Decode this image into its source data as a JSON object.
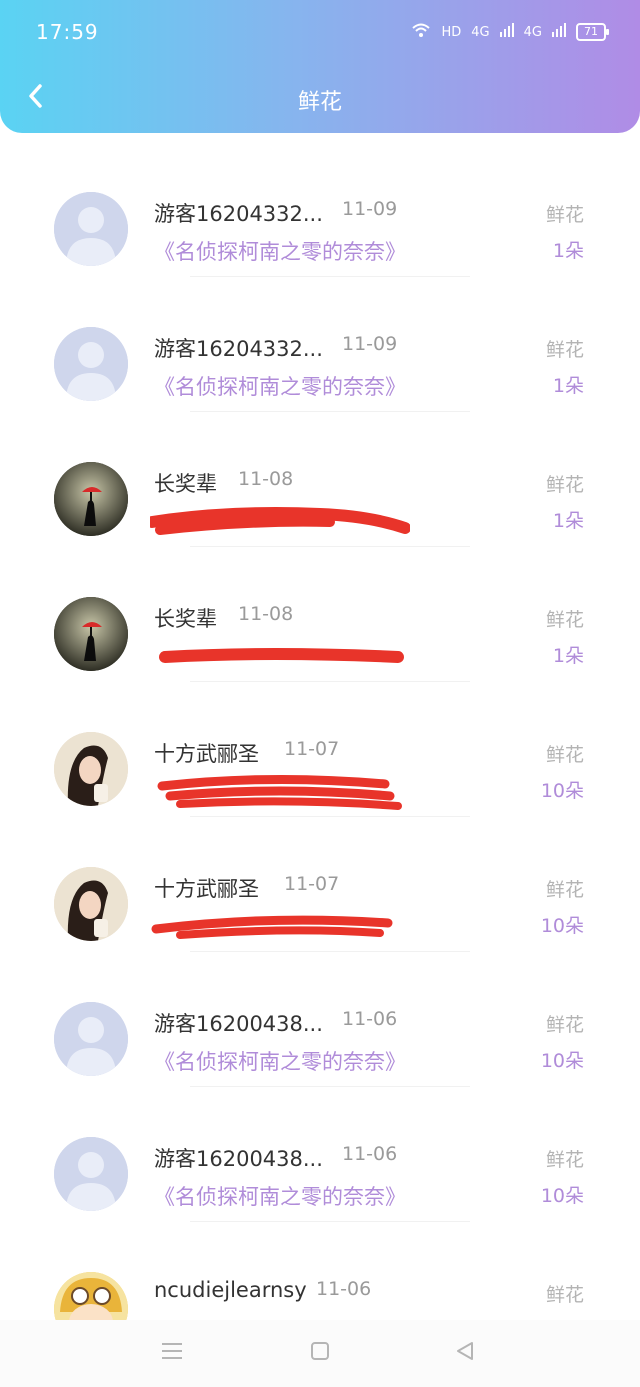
{
  "status_bar": {
    "time": "17:59",
    "network": "HD",
    "signal1": "4G",
    "signal2": "4G",
    "battery": "71"
  },
  "header": {
    "title": "鲜花"
  },
  "records": [
    {
      "name": "游客16204332...",
      "date": "11-09",
      "book": "《名侦探柯南之零的奈奈》",
      "gift_type": "鲜花",
      "count": "1朵",
      "avatar": "default"
    },
    {
      "name": "游客16204332...",
      "date": "11-09",
      "book": "《名侦探柯南之零的奈奈》",
      "gift_type": "鲜花",
      "count": "1朵",
      "avatar": "default"
    },
    {
      "name": "长奖辈",
      "date": "11-08",
      "book": "",
      "gift_type": "鲜花",
      "count": "1朵",
      "avatar": "umbrella-photo"
    },
    {
      "name": "长奖辈",
      "date": "11-08",
      "book": "",
      "gift_type": "鲜花",
      "count": "1朵",
      "avatar": "umbrella-photo"
    },
    {
      "name": "十方武郦圣",
      "date": "11-07",
      "book": "",
      "gift_type": "鲜花",
      "count": "10朵",
      "avatar": "girl-photo"
    },
    {
      "name": "十方武郦圣",
      "date": "11-07",
      "book": "",
      "gift_type": "鲜花",
      "count": "10朵",
      "avatar": "girl-photo"
    },
    {
      "name": "游客16200438...",
      "date": "11-06",
      "book": "《名侦探柯南之零的奈奈》",
      "gift_type": "鲜花",
      "count": "10朵",
      "avatar": "default"
    },
    {
      "name": "游客16200438...",
      "date": "11-06",
      "book": "《名侦探柯南之零的奈奈》",
      "gift_type": "鲜花",
      "count": "10朵",
      "avatar": "default"
    },
    {
      "name": "ncudiejlearnsy",
      "date": "11-06",
      "book": "",
      "gift_type": "鲜花",
      "count": "",
      "avatar": "cartoon"
    }
  ],
  "nav": {
    "menu_icon": "menu-icon",
    "home_icon": "home-icon",
    "back_icon": "back-triangle-icon"
  }
}
